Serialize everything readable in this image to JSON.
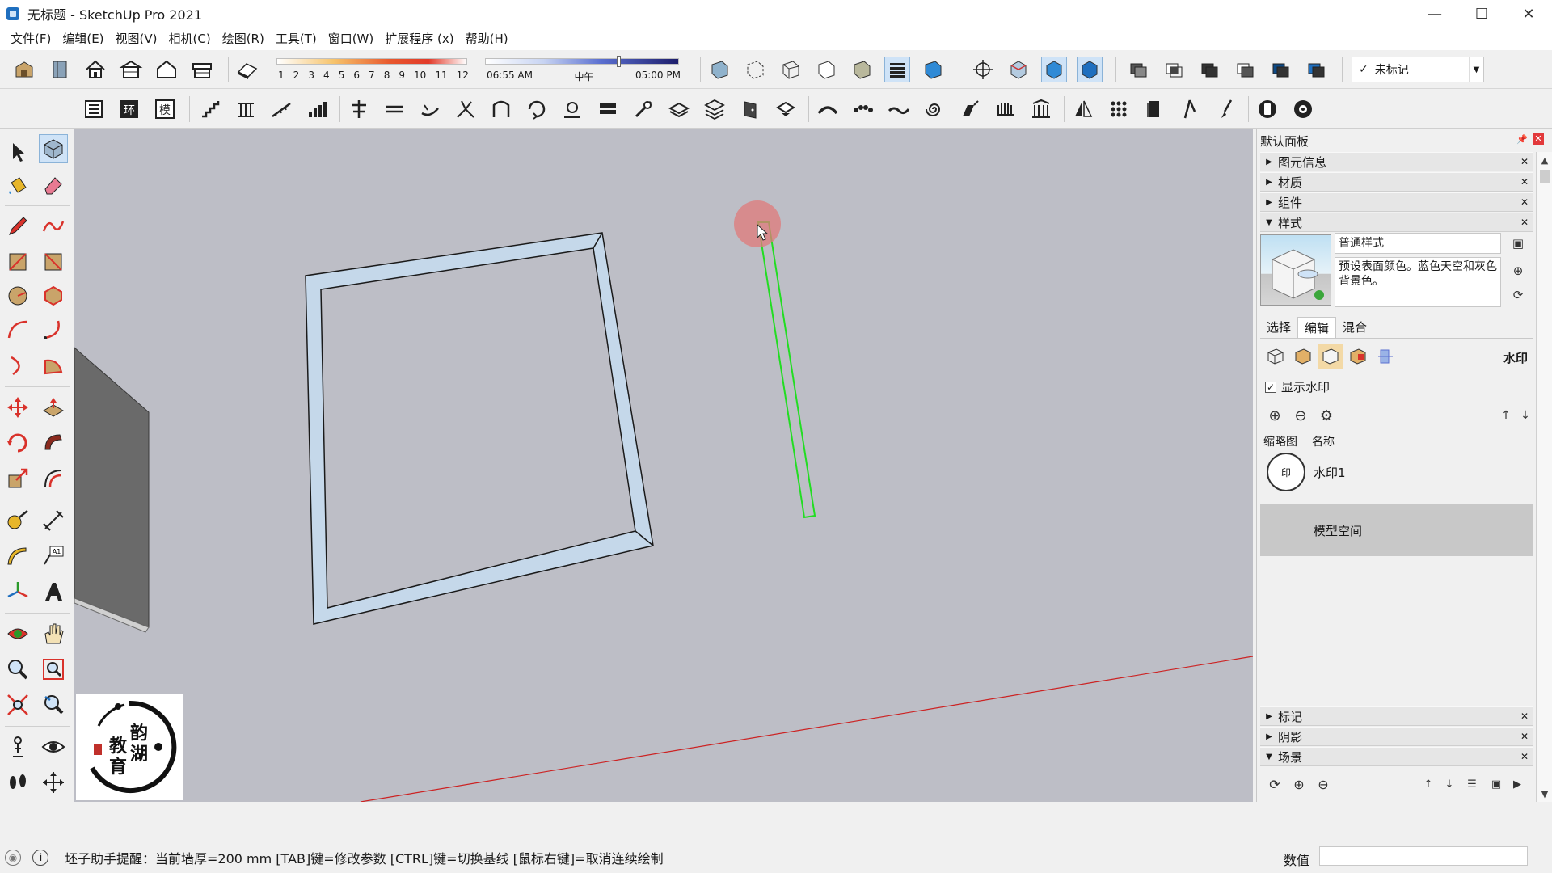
{
  "window": {
    "title": "无标题 - SketchUp Pro 2021",
    "minimize": "—",
    "maximize": "☐",
    "close": "✕"
  },
  "menu": [
    "文件(F)",
    "编辑(E)",
    "视图(V)",
    "相机(C)",
    "绘图(R)",
    "工具(T)",
    "窗口(W)",
    "扩展程序 (x)",
    "帮助(H)"
  ],
  "shadows": {
    "months": [
      "1",
      "2",
      "3",
      "4",
      "5",
      "6",
      "7",
      "8",
      "9",
      "10",
      "11",
      "12"
    ],
    "time_start": "06:55 AM",
    "time_mid": "中午",
    "time_end": "05:00 PM",
    "time_position": 0.68
  },
  "tag_select": {
    "check": "✓",
    "value": "未标记"
  },
  "status": {
    "message": "坯子助手提醒：当前墙厚=200 mm [TAB]键=修改参数 [CTRL]键=切换基线 [鼠标右键]=取消连续绘制",
    "value_label": "数值"
  },
  "panel": {
    "title": "默认面板",
    "trays_top": [
      {
        "label": "图元信息",
        "expanded": false
      },
      {
        "label": "材质",
        "expanded": false
      },
      {
        "label": "组件",
        "expanded": false
      },
      {
        "label": "样式",
        "expanded": true
      }
    ],
    "style": {
      "name": "普通样式",
      "description": "预设表面颜色。蓝色天空和灰色背景色。",
      "tabs": [
        "选择",
        "编辑",
        "混合"
      ],
      "active_tab": "编辑",
      "edit_section": "水印",
      "show_watermark_label": "显示水印",
      "show_watermark": true,
      "col_thumb": "缩略图",
      "col_name": "名称",
      "watermark_name": "水印1",
      "model_space": "模型空间"
    },
    "trays_bottom": [
      {
        "label": "标记",
        "expanded": false
      },
      {
        "label": "阴影",
        "expanded": false
      },
      {
        "label": "场景",
        "expanded": true
      }
    ]
  },
  "colors": {
    "viewport": "#bdbec6",
    "wall_fill": "#c5d8ea",
    "selection": "#22dd22",
    "axis_red": "#cc2222",
    "cursor_highlight": "#e07a7a"
  }
}
